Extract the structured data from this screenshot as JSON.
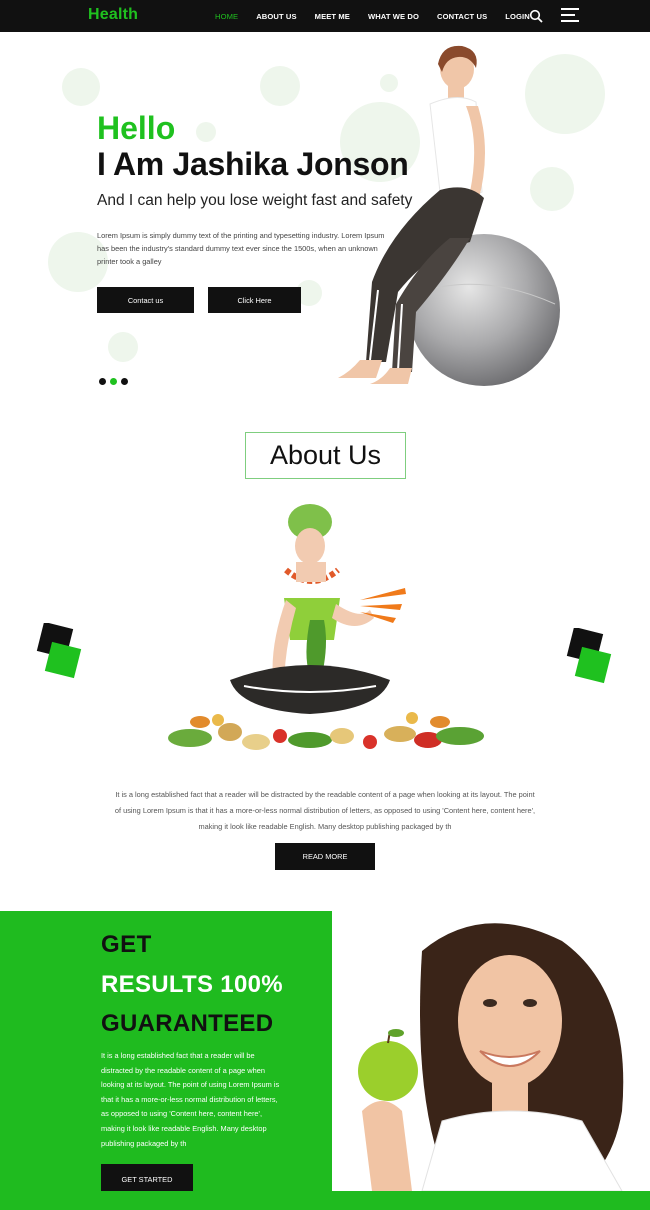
{
  "nav": {
    "logo": "Health",
    "links": [
      "HOME",
      "ABOUT US",
      "MEET ME",
      "WHAT WE DO",
      "CONTACT US",
      "LOGIN"
    ],
    "active_index": 0
  },
  "hero": {
    "hello": "Hello",
    "name": "I Am Jashika Jonson",
    "subtitle": "And I can help you lose weight fast and safety",
    "text_lines": [
      "Lorem Ipsum is simply dummy text of the printing and typesetting industry. Lorem Ipsum",
      "has been the industry's standard dummy text ever since the 1500s, when an unknown",
      "printer took a galley"
    ],
    "btn_contact": "Contact us",
    "btn_click": "Click Here",
    "slider_dots": 3,
    "active_dot": 1
  },
  "about": {
    "heading": "About Us",
    "text_lines": [
      "It is a long established fact that a reader will be distracted by the readable content of a page when looking at its layout. The point",
      "of using Lorem Ipsum is that it has a more-or-less normal distribution of letters, as opposed to using 'Content here, content here',",
      "making it look like readable English. Many desktop publishing packaged by th"
    ],
    "btn_read_more": "READ MORE"
  },
  "results": {
    "line1": "GET",
    "line2": "RESULTS 100%",
    "line3": "GUARANTEED",
    "text_lines": [
      "It is a long established fact that a reader will be",
      "distracted by the readable content of a page when",
      "looking at its layout. The point of using Lorem Ipsum is",
      "that it has a more-or-less normal distribution of letters,",
      "as opposed to using 'Content here, content here',",
      "making it look like readable English. Many desktop",
      "publishing packaged by th"
    ],
    "btn_get_started": "GET STARTED"
  },
  "colors": {
    "accent": "#1fc11f",
    "dark": "#111111",
    "green_panel": "#1fbb1f"
  },
  "icons": {
    "search": "search-icon",
    "menu": "hamburger-menu-icon"
  }
}
